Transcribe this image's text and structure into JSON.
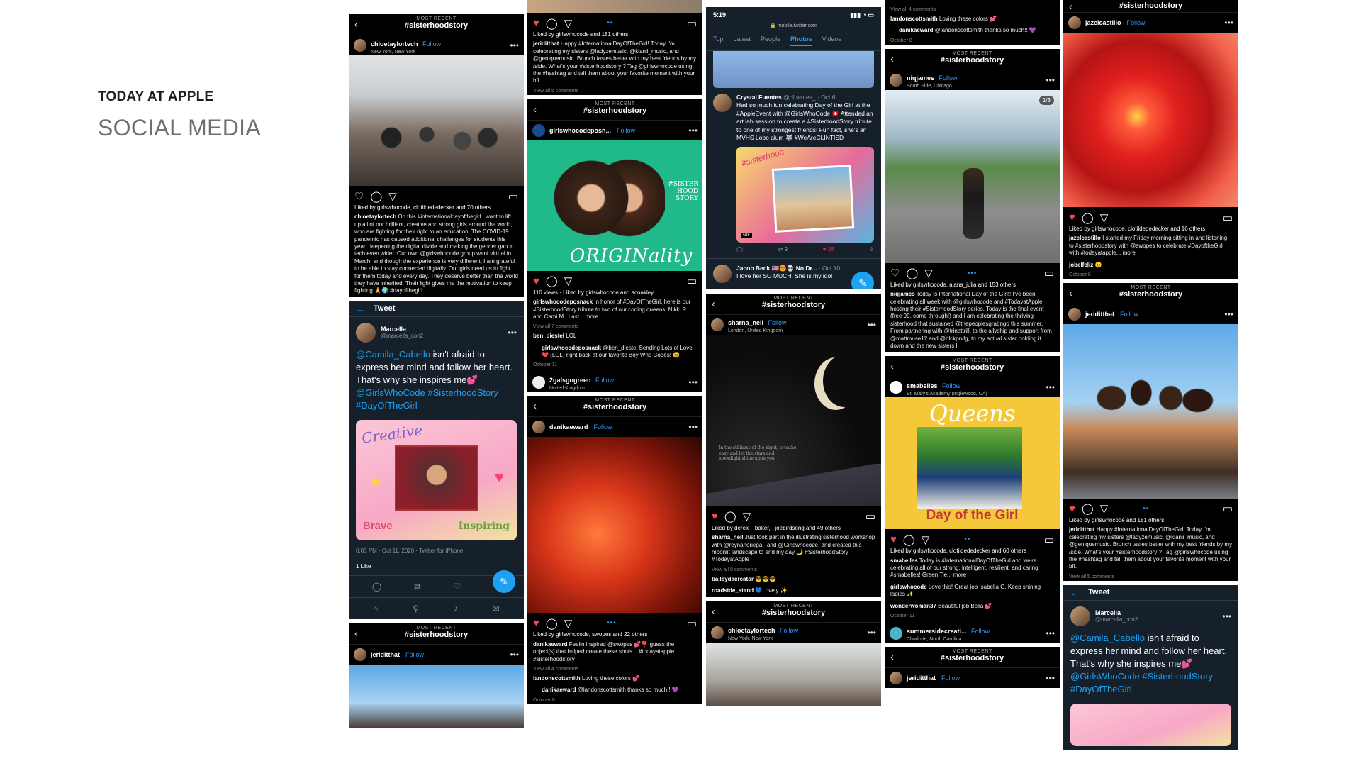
{
  "brand": {
    "kicker": "TODAY AT APPLE",
    "title": "SOCIAL MEDIA"
  },
  "common": {
    "most_recent": "MOST RECENT",
    "hashtag": "#sisterhoodstory",
    "follow": "Follow",
    "tweet_title": "Tweet"
  },
  "col1": {
    "post1": {
      "user": "chloetaylortech",
      "location": "New York, New York",
      "likes": "Liked by girlswhocode, clotildededecker and 70 others",
      "caption_user": "chloetaylortech",
      "caption": "On this #internationaldayofthegirl I want to lift up all of our brilliant, creative and strong girls around the world, who are fighting for their right to an education. The COVID-19 pandemic has caused additional challenges for students this year, deepening the digital divide and making the gender gap in tech even wider. Our own @girlswhocode group went virtual in March, and though the experience is very different, I am grateful to be able to stay connected digitally. Our girls need us to fight for them today and every day. They deserve better than the world they have inherited. Their light gives me the motivation to keep fighting 🙏🌍 #dayofthegirl"
    },
    "tweet": {
      "name": "Marcella",
      "handle": "@marcella_con2",
      "text_mention": "@Camila_Cabello",
      "text_body": " isn't afraid to express her mind and follow her heart. That's why she inspires me💕 ",
      "text_tags": "@GirlsWhoCode #SisterhoodStory #DayOfTheGirl",
      "card_creative": "Creative",
      "card_brave": "Brave",
      "card_inspiring": "Inspiring",
      "time": "6:03 PM · Oct 11, 2020 · Twitter for iPhone",
      "likes": "1 Like"
    },
    "post3": {
      "user": "jeriditthat"
    }
  },
  "col2": {
    "post1": {
      "likes": "Liked by girlswhocode and 181 others",
      "caption_user": "jeriditthat",
      "caption": "Happy #InternationalDayOfTheGirl! Today I'm celebrating my sisters @ladyzemusic, @kianii_music, and @geniquemusic. Brunch tastes better with my best friends by my /side. What's your #sisterhoodstory ? Tag @girlswhocode using the #hashtag and tell them about your favorite moment with your bff.",
      "comments": "View all 5 comments"
    },
    "post2": {
      "user": "girlswhocodeposn...",
      "img_text": "ORIGINality",
      "img_tag": "#SISTER HOOD STORY",
      "views": "116 views · Liked by girlswhocode and acoakley",
      "caption_user": "girlswhocodeposnack",
      "caption": "In honor of #DayOfTheGirl, here is our #SisterhoodStory tribute to two of our coding queens, Nikki R. and Cami M.! Last... more",
      "comments": "View all 7 comments",
      "c1_user": "ben_diestel",
      "c1": "LOL",
      "c2_user": "girlswhocodeposnack",
      "c2": "@ben_diestel Sending Lots of Love ❤️ (LOL) right back at our favorite Boy Who Codes! 😊",
      "date": "October 11",
      "footer_user": "2galsgogreen",
      "footer_loc": "United Kingdom"
    },
    "post3": {
      "user": "danikaeward",
      "likes": "Liked by girlswhocode, swopes and 22 others",
      "caption_user": "danikaeward",
      "caption": "Feelin inspired @swopes 💕❣️ guess the object(s) that helped create these shots... #todayatapple #sisterhoodstory",
      "comments": "View all 4 comments",
      "c1_user": "landonscottsmith",
      "c1": "Loving these colors 💕",
      "c2_user": "danikaeward",
      "c2": "@landonscottsmith thanks so much!! 💜",
      "date": "October 8"
    }
  },
  "col3": {
    "status_time": "5:19",
    "url": "mobile.twitter.com",
    "tabs": [
      "Top",
      "Latest",
      "People",
      "Photos",
      "Videos"
    ],
    "tweet1": {
      "name": "Crystal Fuentes",
      "handle": "@cfuentes_ · Oct 6",
      "text": "Had so much fun celebrating Day of the Girl at the #AppleEvent with @GirlsWhoCode 🇨🇭 Attended an art lab session to create a #SisterhoodStory tribute to one of my strongest friends! Fun fact, she's an MVHS Lobo alum 🐺 #WeAreCLINTISD",
      "img_tag": "#sisterhood",
      "gif": "GIF",
      "stats": [
        "9",
        "26"
      ]
    },
    "tweet2": {
      "name": "Jacob Beck 🇺🇸😍💀 No Dr...",
      "handle": "· Oct 10",
      "text": "I love her SO MUCH. She is my idol"
    },
    "post2": {
      "user": "sharna_neil",
      "location": "London, United Kingdom",
      "moon_text": "In the stillness of the night, breathe easy and let the stars and moonlight shine upon you",
      "likes": "Liked by derek__baker, _joebirdsong and 49 others",
      "caption_user": "sharna_neil",
      "caption": "Just took part in the illustrating sisterhood workshop with @reynanoriega_ and @Girlswhocode, and created this moonlit landscape to end my day 🌙 #SisterhoodStory #TodayatApple",
      "comments": "View all 8 comments",
      "c1_user": "baileydacreator",
      "c1": "😎😎😎",
      "c2_user": "roadside_stand",
      "c2": "💙Lovely ✨"
    },
    "post3": {
      "user": "chloetaylortech",
      "location": "New York, New York"
    }
  },
  "col4": {
    "top": {
      "comments": "View all 4 comments",
      "c1_user": "landonscottsmith",
      "c1": "Loving these colors 💕",
      "c2_user": "danikaeward",
      "c2": "@landonscottsmith thanks so much!! 💜",
      "date": "October 8"
    },
    "post2": {
      "user": "niqjames",
      "location": "South Side, Chicago",
      "counter": "1/3",
      "likes": "Liked by girlswhocode, alana_julia and 153 others",
      "caption_user": "niqjames",
      "caption": "Today is International Day of the Girl!! I've been celebrating all week with @girlswhocode and #TodayatApple hosting their #SisterhoodStory series. Today is the final event (free 99, come through!) and I am celebrating the thriving sisterhood that sustained @thepeoplesgrabngo this summer. From partnering with @trinattrill, to the allyship and support from @mattmuse12 and @blckprvlg, to my actual sister holding it down and the new sisters I"
    },
    "post3": {
      "user": "smabelles",
      "location": "St. Mary's Academy (Inglewood, CA)",
      "img_title": "Queens",
      "img_footer": "Day of the Girl",
      "likes": "Liked by girlswhocode, clotildededecker and 60 others",
      "caption_user": "smabelles",
      "caption": "Today is #InternationalDayOfTheGirl and we're celebrating all of our strong, intelligent, resilient, and caring #smabelles! Green Tie... more",
      "c1_user": "girlswhocode",
      "c1": "Love this! Great job Isabella G. Keep shining ladies ✨",
      "c2_user": "wonderwoman37",
      "c2": "Beautiful job Bella 💕",
      "date": "October 11",
      "footer_user": "summersidecreati...",
      "footer_loc": "Charlotte, North Carolina"
    },
    "post4": {
      "user": "jeriditthat"
    }
  },
  "col5": {
    "post1": {
      "user": "jazelcastillo",
      "likes": "Liked by girlswhocode, clotildededecker and 16 others",
      "caption_user": "jazelcastillo",
      "caption": "I started my Friday morning sitting in and listening to #sisterhoodstory with @swopes to celebrate #DayoftheGirl with #todayatapple... more",
      "c1_user": "jobelfeliz",
      "c1": "😊",
      "date": "October 8"
    },
    "post2": {
      "user": "jeriditthat",
      "likes": "Liked by girlswhocode and 181 others",
      "caption_user": "jeriditthat",
      "caption": "Happy #InternationalDayOfTheGirl! Today I'm celebrating my sisters @ladyzemusic, @kianii_music, and @geniquemusic. Brunch tastes better with my best friends by my /side. What's your #sisterhoodstory ? Tag @girlswhocode using the #hashtag and tell them about your favorite moment with your bff.",
      "comments": "View all 5 comments"
    },
    "tweet": {
      "name": "Marcella",
      "handle": "@marcella_con2",
      "text_mention": "@Camila_Cabello",
      "text_body": " isn't afraid to express her mind and follow her heart. That's why she inspires me💕 ",
      "text_tags": "@GirlsWhoCode #SisterhoodStory #DayOfTheGirl"
    }
  }
}
